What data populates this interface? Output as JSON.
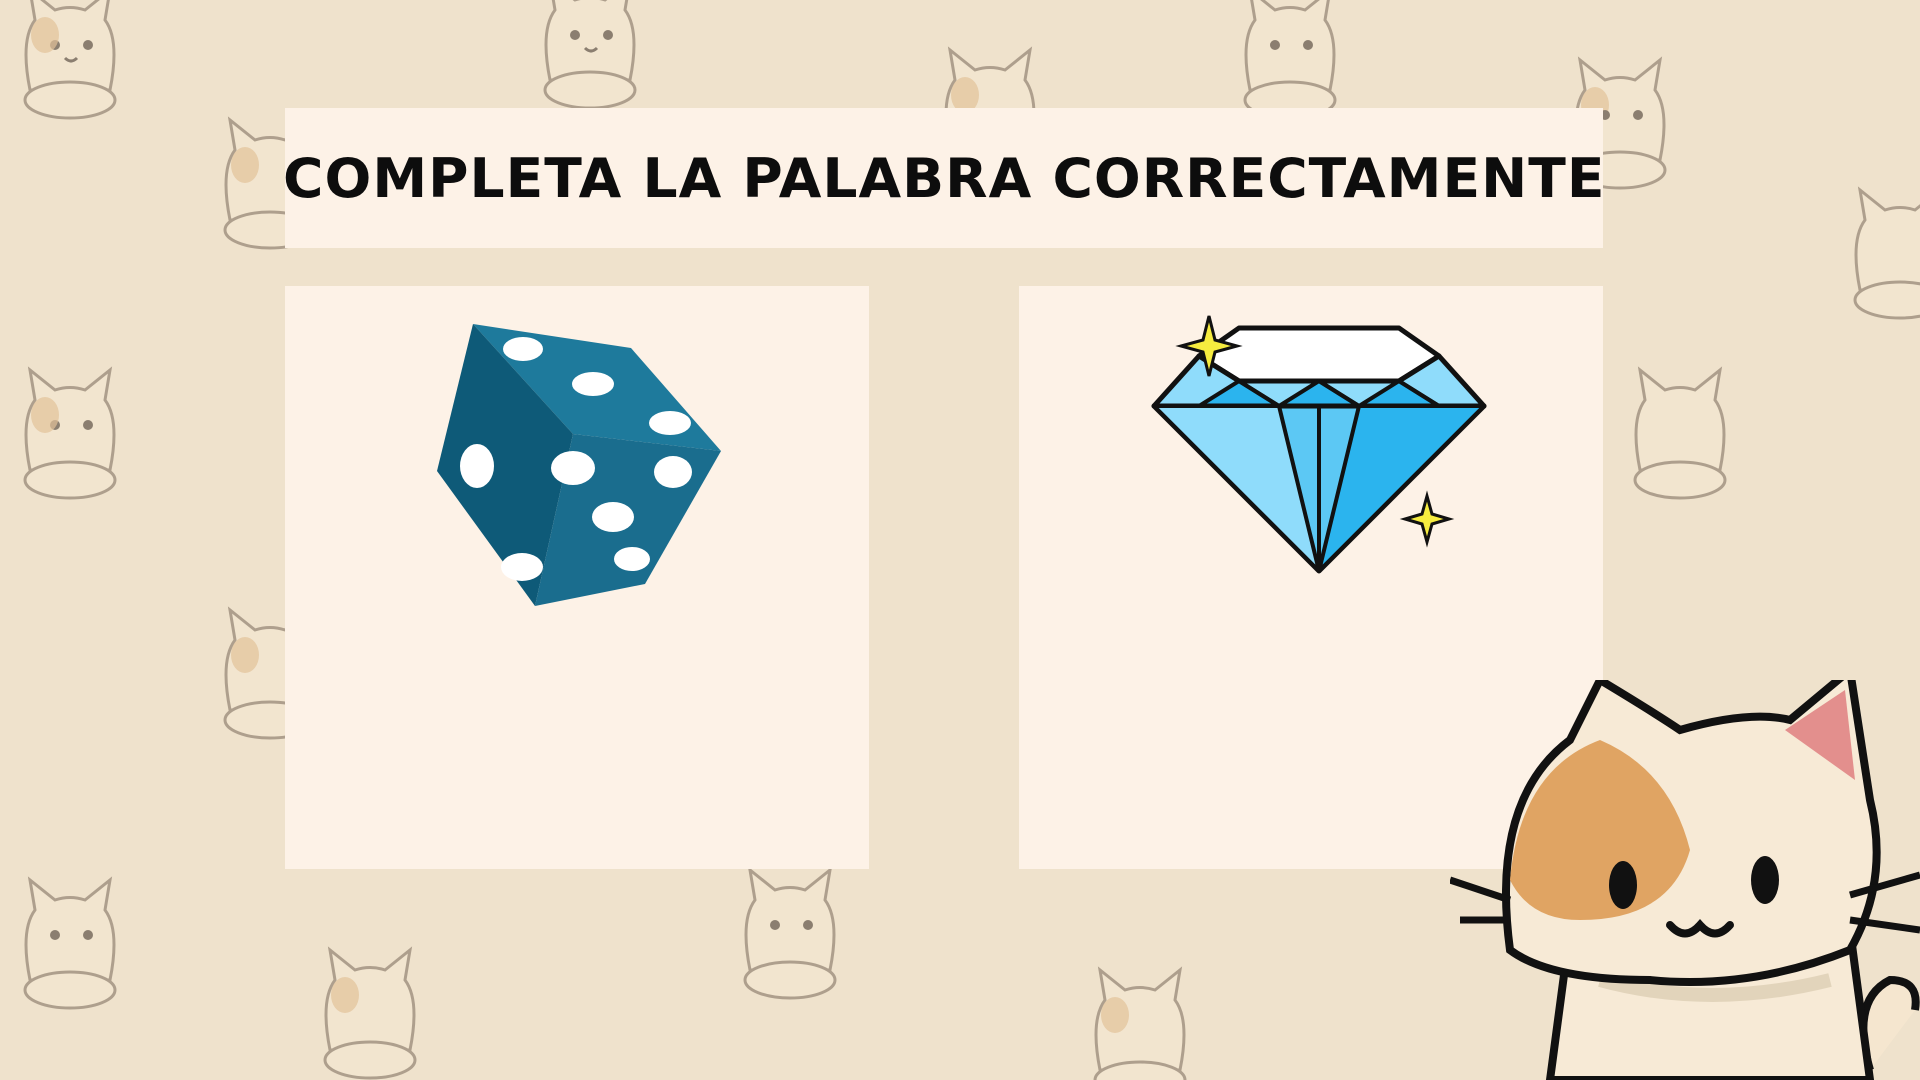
{
  "slide": {
    "title": "COMPLETA LA PALABRA CORRECTAMENTE"
  },
  "panels": [
    {
      "icon": "dice-icon"
    },
    {
      "icon": "diamond-icon"
    }
  ],
  "decorations": {
    "background_icon": "cat-icon",
    "mascot_icon": "cat-mascot-icon"
  },
  "colors": {
    "background": "#efe2cc",
    "card": "#fdf2e7",
    "title_text": "#0d0d0d",
    "dice": "#1a6d8e",
    "diamond": "#5cc8f4",
    "sparkle": "#f6ec3f"
  }
}
